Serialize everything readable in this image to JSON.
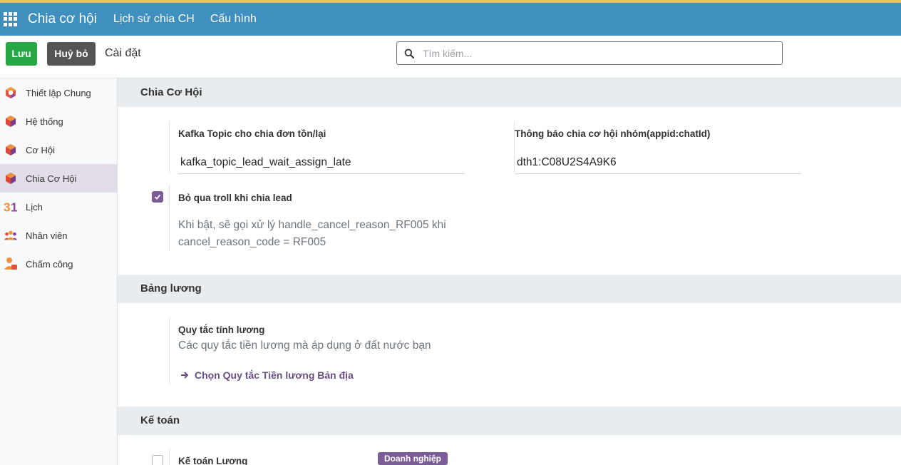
{
  "navbar": {
    "apps_icon": "grid-icon",
    "brand": "Chia cơ hội",
    "menu": [
      "Lịch sử chia CH",
      "Cấu hình"
    ]
  },
  "controlbar": {
    "save_label": "Lưu",
    "discard_label": "Huỷ bỏ",
    "breadcrumb": "Cài đặt",
    "search_placeholder": "Tìm kiếm..."
  },
  "sidebar": {
    "items": [
      {
        "label": "Thiết lập Chung",
        "icon": "settings-app-icon"
      },
      {
        "label": "Hệ thống",
        "icon": "odoo-app-icon"
      },
      {
        "label": "Cơ Hội",
        "icon": "odoo-app-icon"
      },
      {
        "label": "Chia Cơ Hội",
        "icon": "odoo-app-icon",
        "active": true
      },
      {
        "label": "Lịch",
        "icon": "calendar-icon"
      },
      {
        "label": "Nhân viên",
        "icon": "employees-icon"
      },
      {
        "label": "Chấm công",
        "icon": "attendance-icon"
      }
    ]
  },
  "sections": {
    "lead": {
      "title": "Chia Cơ Hội",
      "kafka_label": "Kafka Topic cho chia đơn tồn/lại",
      "kafka_value": "kafka_topic_lead_wait_assign_late",
      "notify_label": "Thông báo chia cơ hội nhóm(appid:chatId)",
      "notify_value": "dth1:C08U2S4A9K6",
      "troll_label": "Bỏ qua troll khi chia lead",
      "troll_help_1": "Khi bật, sẽ gọi xử lý handle_cancel_reason_RF005 khi",
      "troll_help_2": "cancel_reason_code = RF005",
      "troll_checked": true
    },
    "payroll": {
      "title": "Bảng lương",
      "rule_label": "Quy tắc tính lương",
      "rule_help": "Các quy tắc tiền lương mà áp dụng ở đất nước bạn",
      "rule_link": "Chọn Quy tắc Tiền lương Bản địa"
    },
    "accounting": {
      "title": "Kế toán",
      "payroll_acc_label": "Kế toán Lương",
      "badge": "Doanh nghiệp",
      "payroll_acc_checked": false
    }
  },
  "colors": {
    "navbar": "#3f8fbf",
    "save": "#28a745",
    "discard": "#555555",
    "accent": "#7b5d96"
  }
}
